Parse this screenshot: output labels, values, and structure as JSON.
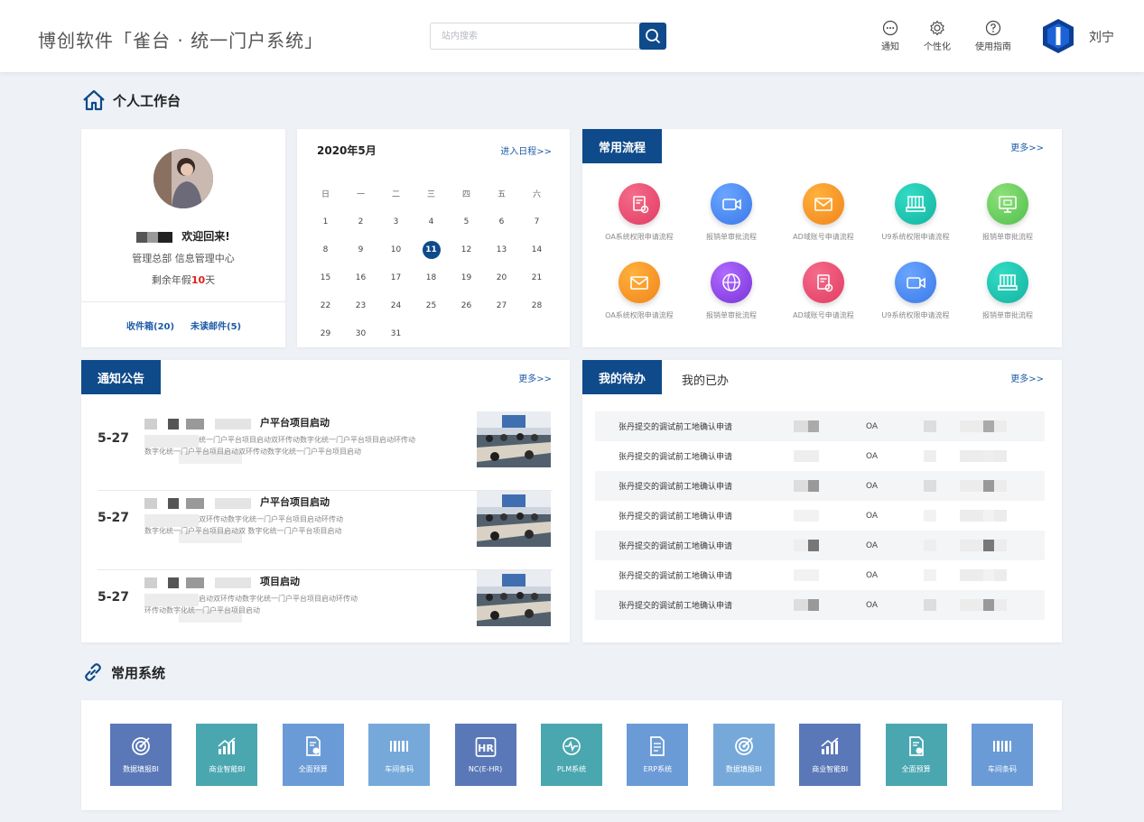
{
  "header": {
    "app_title": "博创软件「雀台 · 统一门户系统」",
    "search_placeholder": "站内搜索",
    "actions": [
      {
        "label": "通知",
        "icon": "chat-icon"
      },
      {
        "label": "个性化",
        "icon": "gear-icon"
      },
      {
        "label": "使用指南",
        "icon": "help-icon"
      }
    ],
    "user_name": "刘宁"
  },
  "workbench": {
    "title": "个人工作台"
  },
  "profile": {
    "welcome": "欢迎回来!",
    "dept": "管理总部  信息管理中心",
    "leave_prefix": "剩余年假",
    "leave_days": "10",
    "leave_suffix": "天",
    "inbox": "收件箱(20)",
    "unread": "未读邮件(5)"
  },
  "calendar": {
    "month": "2020年5月",
    "link": "进入日程>>",
    "weekdays": [
      "日",
      "一",
      "二",
      "三",
      "四",
      "五",
      "六"
    ],
    "weeks": [
      [
        "1",
        "2",
        "3",
        "4",
        "5",
        "6",
        "7"
      ],
      [
        "8",
        "9",
        "10",
        "11",
        "12",
        "13",
        "14"
      ],
      [
        "15",
        "16",
        "17",
        "18",
        "19",
        "20",
        "21"
      ],
      [
        "22",
        "23",
        "24",
        "25",
        "26",
        "27",
        "28"
      ],
      [
        "29",
        "30",
        "31",
        "",
        "",
        "",
        ""
      ]
    ],
    "today": "11"
  },
  "processes": {
    "title": "常用流程",
    "more": "更多>>",
    "items": [
      {
        "label": "OA系统权限申请流程",
        "icon": "document-gear-icon",
        "color_a": "#f46b8a",
        "color_b": "#e23c63"
      },
      {
        "label": "报销单审批流程",
        "icon": "video-camera-icon",
        "color_a": "#6aa6ff",
        "color_b": "#3a78e8"
      },
      {
        "label": "AD域账号申请流程",
        "icon": "envelope-icon",
        "color_a": "#ffb13d",
        "color_b": "#f0851a"
      },
      {
        "label": "U9系统权限申请流程",
        "icon": "server-icon",
        "color_a": "#33dcc5",
        "color_b": "#12b3a0"
      },
      {
        "label": "报销单审批流程",
        "icon": "monitor-icon",
        "color_a": "#8ee07a",
        "color_b": "#4fc04b"
      },
      {
        "label": "OA系统权限申请流程",
        "icon": "envelope-icon",
        "color_a": "#ffb13d",
        "color_b": "#f0851a"
      },
      {
        "label": "报销单审批流程",
        "icon": "globe-icon",
        "color_a": "#b06bff",
        "color_b": "#7a32d8"
      },
      {
        "label": "AD域账号申请流程",
        "icon": "document-gear-icon",
        "color_a": "#f46b8a",
        "color_b": "#e23c63"
      },
      {
        "label": "U9系统权限申请流程",
        "icon": "video-camera-icon",
        "color_a": "#6aa6ff",
        "color_b": "#3a78e8"
      },
      {
        "label": "报销单审批流程",
        "icon": "server-icon",
        "color_a": "#33dcc5",
        "color_b": "#12b3a0"
      }
    ]
  },
  "notices": {
    "title": "通知公告",
    "more": "更多>>",
    "items": [
      {
        "date": "5-27",
        "title": "户平台项目启动",
        "line1": "统一门户平台项目启动双环传动数字化统一门户平台项目启动环传动",
        "line2": "数字化统一门户平台项目启动双环传动数字化统一门户平台项目启动"
      },
      {
        "date": "5-27",
        "title": "户平台项目启动",
        "line1": "双环传动数字化统一门户平台项目启动环传动",
        "line2": "数字化统一门户平台项目启动双    数字化统一门户平台项目启动"
      },
      {
        "date": "5-27",
        "title": "项目启动",
        "line1": "启动双环传动数字化统一门户平台项目启动环传动",
        "line2": "环传动数字化统一门户平台项目启动"
      }
    ]
  },
  "todo": {
    "tab_active": "我的待办",
    "tab_inactive": "我的已办",
    "more": "更多>>",
    "rows": [
      {
        "title": "张丹提交的调试前工地确认申请",
        "type": "OA"
      },
      {
        "title": "张丹提交的调试前工地确认申请",
        "type": "OA"
      },
      {
        "title": "张丹提交的调试前工地确认申请",
        "type": "OA"
      },
      {
        "title": "张丹提交的调试前工地确认申请",
        "type": "OA"
      },
      {
        "title": "张丹提交的调试前工地确认申请",
        "type": "OA"
      },
      {
        "title": "张丹提交的调试前工地确认申请",
        "type": "OA"
      },
      {
        "title": "张丹提交的调试前工地确认申请",
        "type": "OA"
      }
    ]
  },
  "systems": {
    "title": "常用系统",
    "items": [
      {
        "label": "数据填报BI",
        "icon": "target-icon",
        "color": "#5a78b8"
      },
      {
        "label": "商业智能BI",
        "icon": "chart-up-icon",
        "color": "#4aa7b0"
      },
      {
        "label": "全面预算",
        "icon": "document-coin-icon",
        "color": "#6a9bd6"
      },
      {
        "label": "车间条码",
        "icon": "barcode-icon",
        "color": "#76a9d9"
      },
      {
        "label": "NC(E-HR)",
        "icon": "hr-icon",
        "color": "#5a78b8"
      },
      {
        "label": "PLM系统",
        "icon": "pulse-icon",
        "color": "#4aa7b0"
      },
      {
        "label": "ERP系统",
        "icon": "document-icon",
        "color": "#6a9bd6"
      },
      {
        "label": "数据填报BI",
        "icon": "target-icon",
        "color": "#76a9d9"
      },
      {
        "label": "商业智能BI",
        "icon": "chart-up-icon",
        "color": "#5a78b8"
      },
      {
        "label": "全面预算",
        "icon": "document-coin-icon",
        "color": "#4aa7b0"
      },
      {
        "label": "车间条码",
        "icon": "barcode-icon",
        "color": "#6a9bd6"
      }
    ]
  },
  "colors": {
    "primary": "#0f4a8a",
    "link": "#1f5ca8",
    "highlight": "#e0211d"
  }
}
